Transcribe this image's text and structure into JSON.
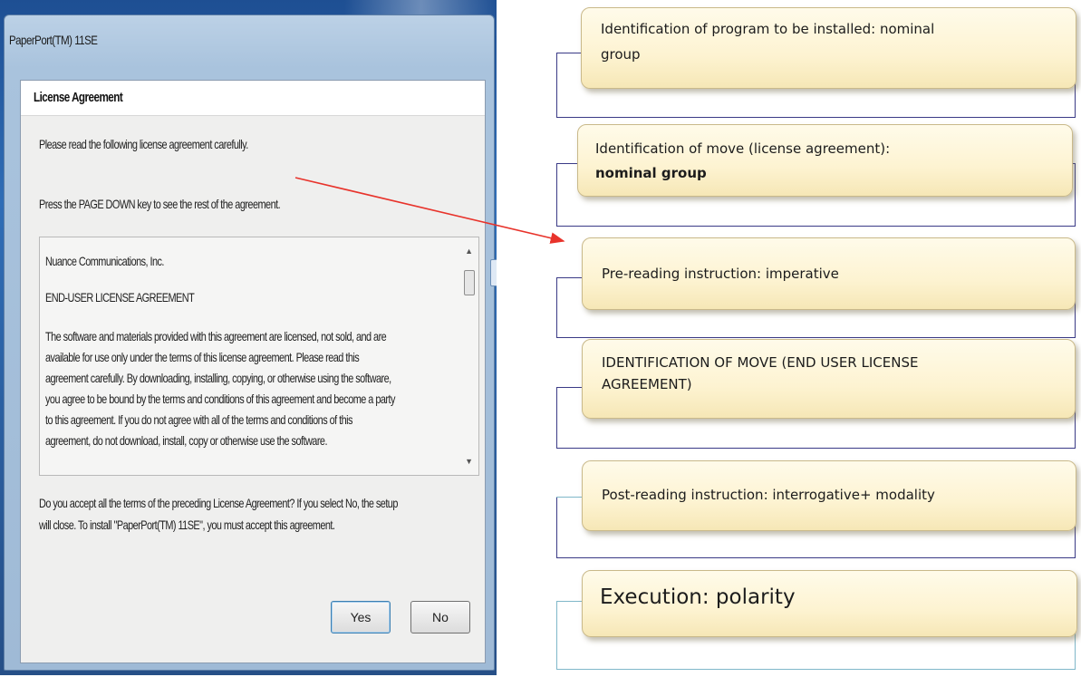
{
  "dialog": {
    "window_title": "PaperPort(TM) 11SE",
    "header_title": "License Agreement",
    "instruction_1": "Please read the following license agreement carefully.",
    "instruction_2": "Press the PAGE DOWN key to see the rest of the agreement.",
    "license_lines": [
      "Nuance Communications, Inc.",
      "END-USER LICENSE AGREEMENT",
      "The software and materials provided with this agreement are licensed, not sold, and are",
      "available for use only under the terms of this license agreement. Please read this",
      "agreement carefully. By downloading, installing, copying, or otherwise using the software,",
      "you agree to be bound by the terms and conditions of this agreement and become a party",
      "to this agreement. If you do not agree with all of the terms and conditions of this",
      "agreement, do not download, install, copy or otherwise use the software."
    ],
    "question_line_1": "Do you accept all the terms of the preceding License Agreement?  If you select No,  the setup",
    "question_line_2": "will close.  To install \"PaperPort(TM) 11SE\", you must accept this agreement.",
    "yes_label": "Yes",
    "no_label": "No"
  },
  "diagram": {
    "boxes": [
      {
        "line1": "Identification of program to be  installed: nominal",
        "line2": "group"
      },
      {
        "line1": "Identification of move (license agreement):",
        "line2": "nominal group"
      },
      {
        "line1": "Pre-reading instruction: imperative",
        "line2": ""
      },
      {
        "line1": "IDENTIFICATION OF MOVE (END USER LICENSE",
        "line2": "AGREEMENT)"
      },
      {
        "line1": "Post-reading instruction: interrogative+ modality",
        "line2": ""
      },
      {
        "line1": "Execution: polarity",
        "line2": ""
      }
    ],
    "arrow_color": "#e8332b",
    "panel_border_color": "#3a3a86"
  }
}
